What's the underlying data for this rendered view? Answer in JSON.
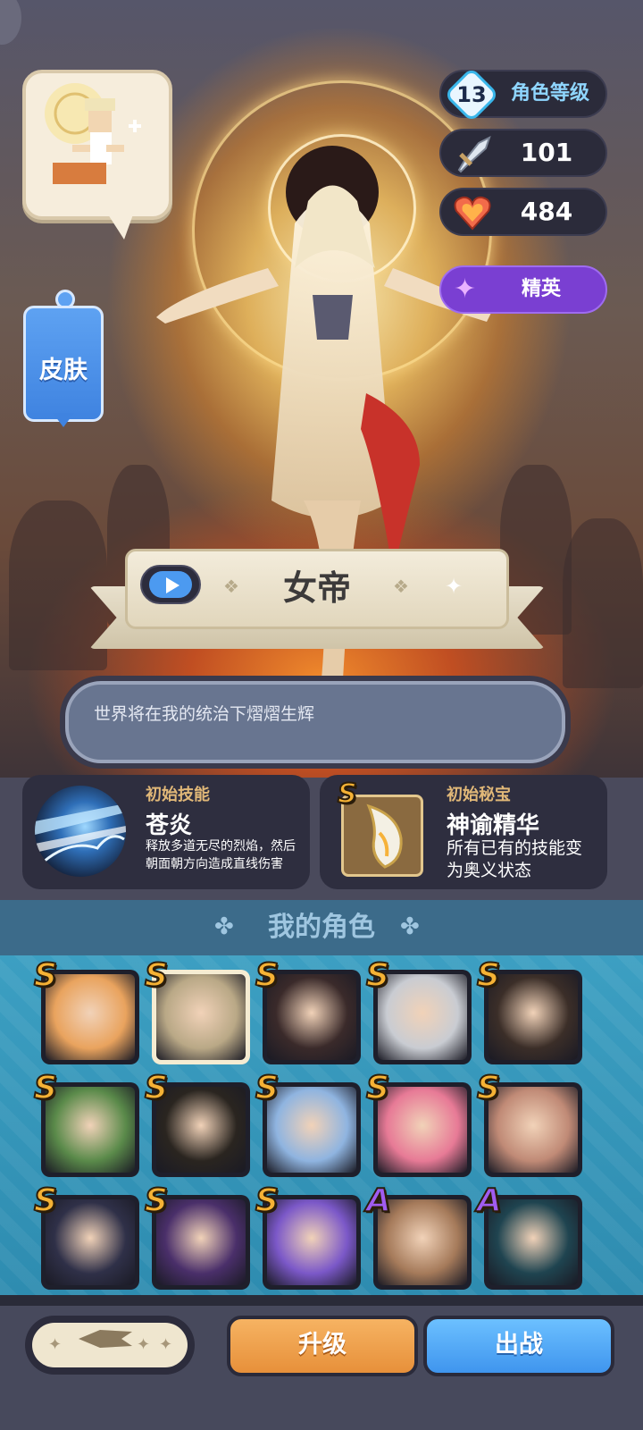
{
  "stats": {
    "level": "13",
    "level_label": "角色等级",
    "attack": "101",
    "health": "484",
    "rank": "精英"
  },
  "skin_label": "皮肤",
  "hero": {
    "name": "女帝",
    "quote": "世界将在我的统治下熠熠生辉"
  },
  "skill": {
    "caption": "初始技能",
    "name": "苍炎",
    "desc": "释放多道无尽的烈焰，然后朝面朝方向造成直线伤害"
  },
  "treasure": {
    "caption": "初始秘宝",
    "grade": "S",
    "name": "神谕精华",
    "desc": "所有已有的技能变为奥义状态"
  },
  "roster": {
    "title": "我的角色",
    "rows": [
      [
        {
          "grade": "S",
          "color": "#e9a35e"
        },
        {
          "grade": "S",
          "color": "#b9a886",
          "selected": true
        },
        {
          "grade": "S",
          "color": "#3a2a2a"
        },
        {
          "grade": "S",
          "color": "#c9ccd2"
        },
        {
          "grade": "S",
          "color": "#3b2e28"
        }
      ],
      [
        {
          "grade": "S",
          "color": "#5a8a4a"
        },
        {
          "grade": "S",
          "color": "#2a2520"
        },
        {
          "grade": "S",
          "color": "#8fb4e0"
        },
        {
          "grade": "S",
          "color": "#e77a96"
        },
        {
          "grade": "S",
          "color": "#c08a76"
        }
      ],
      [
        {
          "grade": "S",
          "color": "#2f3048"
        },
        {
          "grade": "S",
          "color": "#4a2f6a"
        },
        {
          "grade": "S",
          "color": "#7b58c8"
        },
        {
          "grade": "A",
          "color": "#a57a5a"
        },
        {
          "grade": "A",
          "color": "#1f4450"
        }
      ]
    ]
  },
  "buttons": {
    "upgrade": "升级",
    "deploy": "出战"
  },
  "colors": {
    "accent_blue": "#3f95ee",
    "accent_orange": "#e7903a",
    "rank_purple": "#7a3fd2",
    "grade_s": "#f5b235",
    "grade_a": "#a05cf0"
  }
}
